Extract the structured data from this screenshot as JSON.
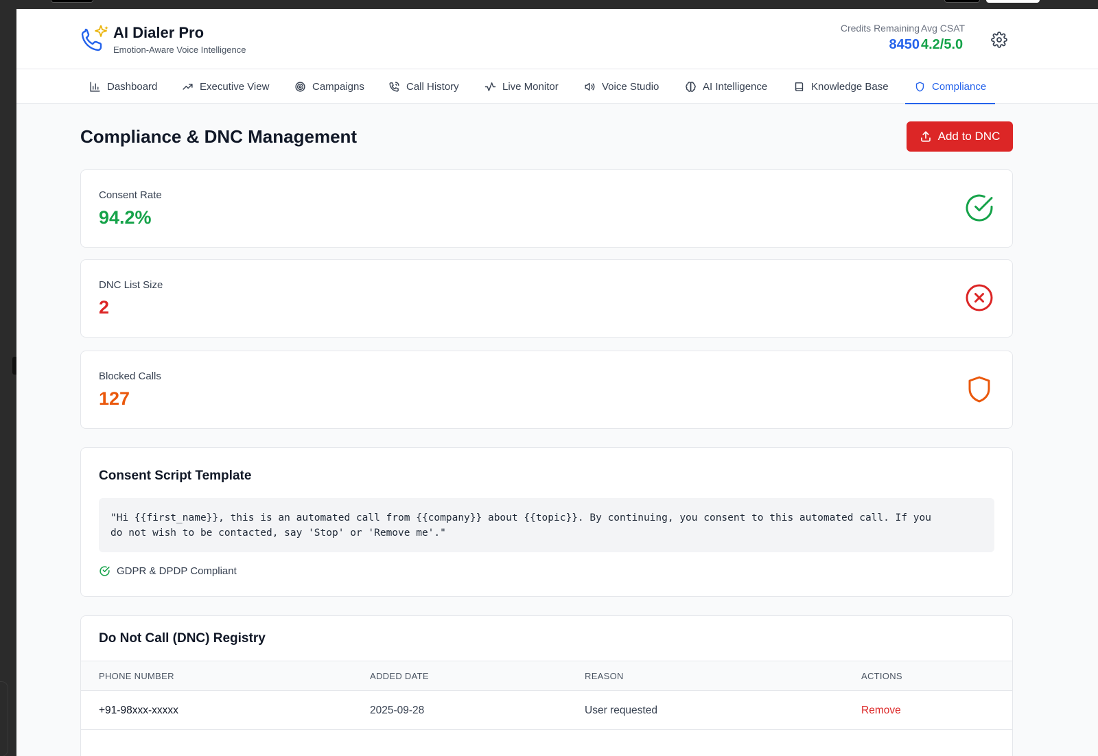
{
  "app": {
    "title": "AI Dialer Pro",
    "subtitle": "Emotion-Aware Voice Intelligence",
    "brand_color": "#2563eb",
    "accent_sparkle_color": "#eab308"
  },
  "header_stats": {
    "credits": {
      "label": "Credits Remaining",
      "value": "8450",
      "color": "#2563eb"
    },
    "csat": {
      "label": "Avg CSAT",
      "value": "4.2/5.0",
      "color": "#16a34a"
    },
    "settings_icon": "gear-icon"
  },
  "nav": {
    "tabs": [
      {
        "label": "Dashboard",
        "icon": "bar-chart-icon"
      },
      {
        "label": "Executive View",
        "icon": "trending-up-icon"
      },
      {
        "label": "Campaigns",
        "icon": "target-icon"
      },
      {
        "label": "Call History",
        "icon": "phone-call-icon"
      },
      {
        "label": "Live Monitor",
        "icon": "activity-icon"
      },
      {
        "label": "Voice Studio",
        "icon": "volume-icon"
      },
      {
        "label": "AI Intelligence",
        "icon": "brain-icon"
      },
      {
        "label": "Knowledge Base",
        "icon": "book-icon"
      },
      {
        "label": "Compliance",
        "icon": "shield-icon",
        "active": true
      }
    ]
  },
  "page": {
    "title": "Compliance & DNC Management",
    "add_button_label": "Add to DNC",
    "add_button_color": "#dc2626"
  },
  "metrics": [
    {
      "label": "Consent Rate",
      "value": "94.2%",
      "color": "#16a34a",
      "icon": "check-circle-icon"
    },
    {
      "label": "DNC List Size",
      "value": "2",
      "color": "#dc2626",
      "icon": "x-circle-icon"
    },
    {
      "label": "Blocked Calls",
      "value": "127",
      "color": "#ea580c",
      "icon": "shield-icon"
    }
  ],
  "consent_script": {
    "title": "Consent Script Template",
    "text_line1": "\"Hi {{first_name}}, this is an automated call from {{company}} about {{topic}}. By continuing, you consent to this automated call. If you",
    "text_line2": "do not wish to be contacted, say 'Stop' or 'Remove me'.\"",
    "badge": "GDPR & DPDP Compliant"
  },
  "dnc_registry": {
    "title": "Do Not Call (DNC) Registry",
    "columns": [
      "PHONE NUMBER",
      "ADDED DATE",
      "REASON",
      "ACTIONS"
    ],
    "rows": [
      {
        "phone": "+91-98xxx-xxxxx",
        "added": "2025-09-28",
        "reason": "User requested",
        "action": "Remove"
      }
    ]
  }
}
